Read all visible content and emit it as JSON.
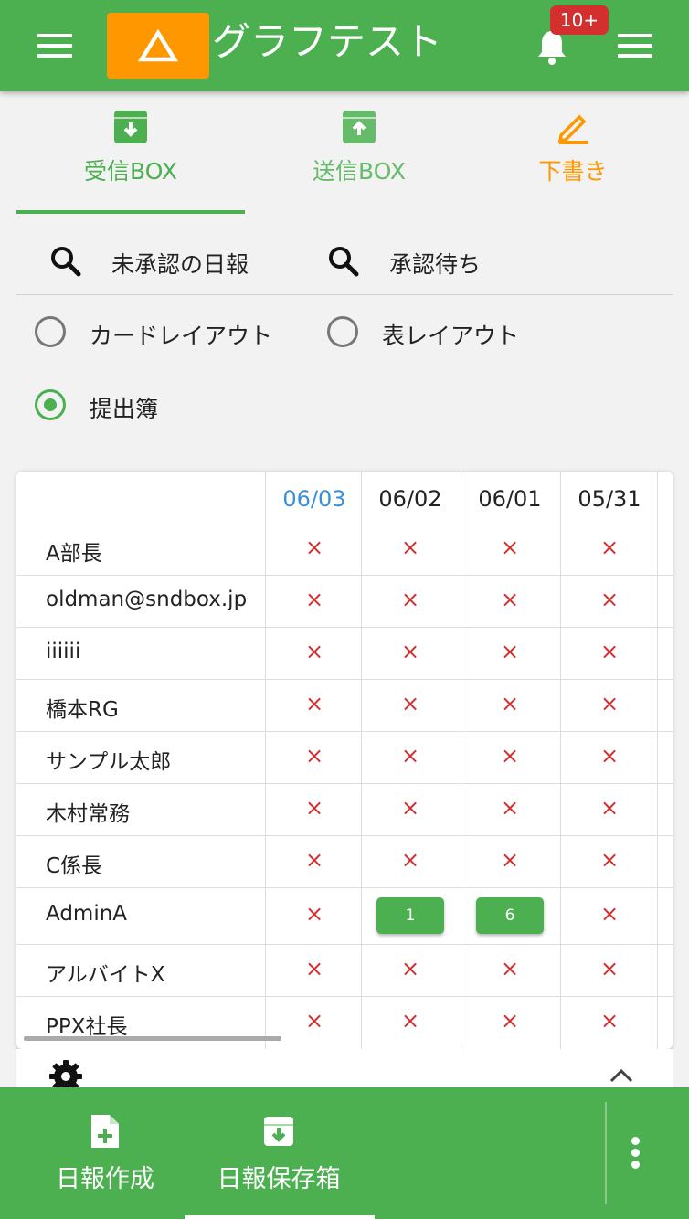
{
  "header": {
    "title": "グラフテスト",
    "notification_badge": "10+",
    "colors": {
      "bar": "#4caf50",
      "logo": "#ff9800",
      "badge": "#d32f2f"
    }
  },
  "tabs": [
    {
      "label": "受信BOX",
      "icon": "inbox-download-icon",
      "color": "#4caf50",
      "active": true
    },
    {
      "label": "送信BOX",
      "icon": "outbox-upload-icon",
      "color": "#66bb6a",
      "active": false
    },
    {
      "label": "下書き",
      "icon": "pencil-edit-icon",
      "color": "#ff9800",
      "active": false
    }
  ],
  "search": [
    {
      "label": "未承認の日報",
      "icon": "search-icon"
    },
    {
      "label": "承認待ち",
      "icon": "search-icon"
    }
  ],
  "layout_options": [
    {
      "label": "カードレイアウト",
      "checked": false
    },
    {
      "label": "表レイアウト",
      "checked": false
    },
    {
      "label": "提出簿",
      "checked": true
    }
  ],
  "table": {
    "columns": [
      "06/03",
      "06/02",
      "06/01",
      "05/31"
    ],
    "highlight_column_color": "#3a8fd8",
    "rows": [
      {
        "name": "A部長",
        "cells": [
          "×",
          "×",
          "×",
          "×"
        ]
      },
      {
        "name": "oldman@sndbox.jp",
        "cells": [
          "×",
          "×",
          "×",
          "×"
        ]
      },
      {
        "name": "iiiiii",
        "cells": [
          "×",
          "×",
          "×",
          "×"
        ]
      },
      {
        "name": "橋本RG",
        "cells": [
          "×",
          "×",
          "×",
          "×"
        ]
      },
      {
        "name": "サンプル太郎",
        "cells": [
          "×",
          "×",
          "×",
          "×"
        ]
      },
      {
        "name": "木村常務",
        "cells": [
          "×",
          "×",
          "×",
          "×"
        ]
      },
      {
        "name": "C係長",
        "cells": [
          "×",
          "×",
          "×",
          "×"
        ]
      },
      {
        "name": "AdminA",
        "cells": [
          "×",
          "1",
          "6",
          "×"
        ]
      },
      {
        "name": "アルバイトX",
        "cells": [
          "×",
          "×",
          "×",
          "×"
        ]
      },
      {
        "name": "PPX社長",
        "cells": [
          "×",
          "×",
          "×",
          "×"
        ]
      }
    ]
  },
  "bottom_nav": [
    {
      "label": "日報作成",
      "icon": "new-document-icon"
    },
    {
      "label": "日報保存箱",
      "icon": "archive-box-icon"
    }
  ],
  "icons": {
    "menu_left": "hamburger-menu-icon",
    "menu_right": "hamburger-menu-icon",
    "notifications": "bell-icon",
    "settings": "gear-icon",
    "collapse": "chevron-up-icon",
    "more": "kebab-menu-icon"
  }
}
